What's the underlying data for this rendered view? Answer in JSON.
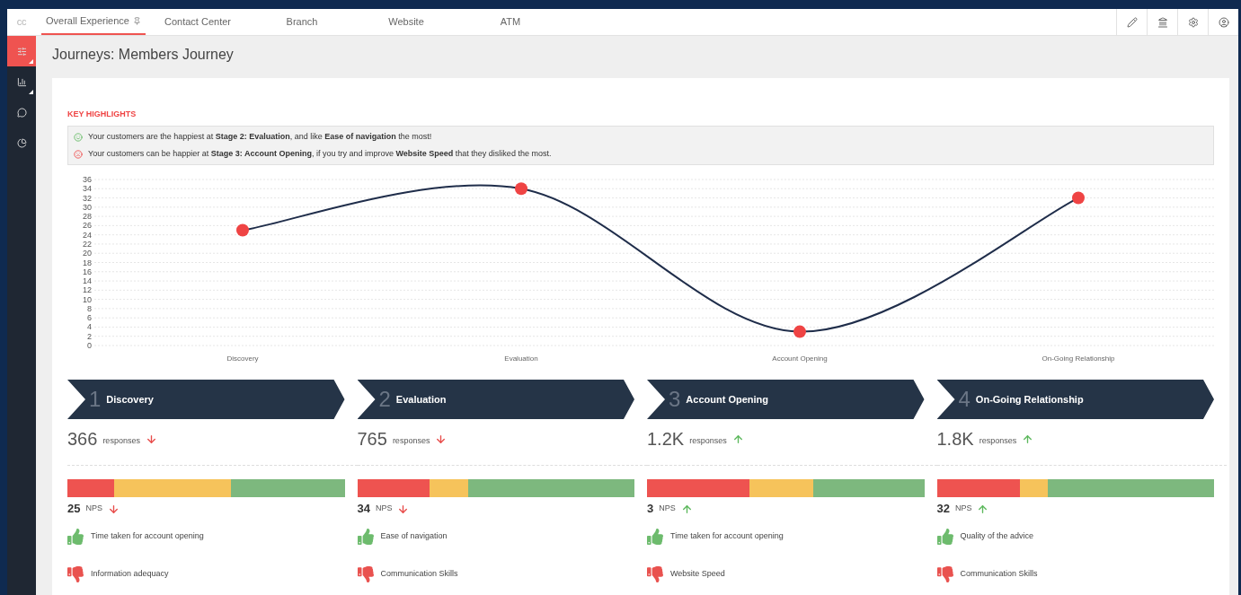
{
  "logo": "cc",
  "tabs": [
    {
      "label": "Overall Experience",
      "selected": true,
      "pinned": true
    },
    {
      "label": "Contact Center",
      "selected": false,
      "pinned": false
    },
    {
      "label": "Branch",
      "selected": false,
      "pinned": false
    },
    {
      "label": "Website",
      "selected": false,
      "pinned": false
    },
    {
      "label": "ATM",
      "selected": false,
      "pinned": false
    }
  ],
  "sidebar": {
    "items": [
      {
        "selected": true,
        "has_submenu": true
      },
      {
        "selected": false,
        "has_submenu": true
      },
      {
        "selected": false,
        "has_submenu": false
      },
      {
        "selected": false,
        "has_submenu": false
      }
    ]
  },
  "page_title": "Journeys: Members Journey",
  "key_highlights": {
    "title": "KEY HIGHLIGHTS",
    "items": [
      {
        "kind": "happy",
        "text": "Your customers are the happiest at **Stage 2: Evaluation**, and like **Ease of navigation** the most!"
      },
      {
        "kind": "sad",
        "text": "Your customers can be happier at **Stage 3: Account Opening**, if you try and improve **Website Speed** that they disliked the most."
      }
    ]
  },
  "chart_data": {
    "type": "line",
    "categories": [
      "Discovery",
      "Evaluation",
      "Account Opening",
      "On-Going Relationship"
    ],
    "grid": true,
    "series": [
      {
        "color": "#1f2d4a",
        "marker": "circle",
        "values": [
          25,
          34,
          3,
          32
        ]
      }
    ],
    "ylim": [
      0,
      36
    ],
    "yticks": [
      0,
      2,
      4,
      6,
      8,
      10,
      12,
      14,
      16,
      18,
      20,
      22,
      24,
      26,
      28,
      30,
      32,
      34,
      36
    ]
  },
  "stages": [
    {
      "number": "1",
      "name": "Discovery",
      "responses": "366",
      "responses_label": "responses",
      "responses_up": false,
      "nps": "25",
      "nps_label": "NPS",
      "nps_up": false,
      "detractors": {
        "level": 0.17
      },
      "non_promoters": {
        "level": 0.59
      },
      "liked": "Time taken for account opening",
      "disliked": "Information adequacy"
    },
    {
      "number": "2",
      "name": "Evaluation",
      "responses": "765",
      "responses_label": "responses",
      "responses_up": false,
      "nps": "34",
      "nps_label": "NPS",
      "nps_up": false,
      "detractors": {
        "level": 0.26
      },
      "non_promoters": {
        "level": 0.4
      },
      "liked": "Ease of navigation",
      "disliked": "Communication Skills"
    },
    {
      "number": "3",
      "name": "Account Opening",
      "responses": "1.2K",
      "responses_label": "responses",
      "responses_up": true,
      "nps": "3",
      "nps_label": "NPS",
      "nps_up": true,
      "detractors": {
        "level": 0.37
      },
      "non_promoters": {
        "level": 0.6
      },
      "liked": "Time taken for account opening",
      "disliked": "Website Speed"
    },
    {
      "number": "4",
      "name": "On-Going Relationship",
      "responses": "1.8K",
      "responses_label": "responses",
      "responses_up": true,
      "nps": "32",
      "nps_label": "NPS",
      "nps_up": true,
      "detractors": {
        "level": 0.3
      },
      "non_promoters": {
        "level": 0.4
      },
      "liked": "Quality of the advice",
      "disliked": "Communication Skills"
    }
  ]
}
